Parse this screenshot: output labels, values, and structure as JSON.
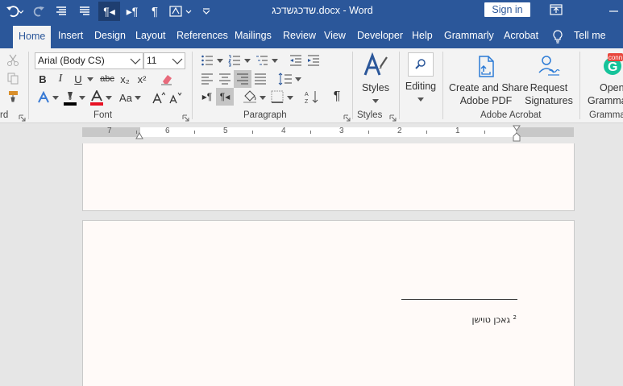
{
  "title_bar": {
    "document_title": "שדכגשדכג.docx  -  Word",
    "signin_label": "Sign in"
  },
  "tabs": [
    "Home",
    "Insert",
    "Design",
    "Layout",
    "References",
    "Mailings",
    "Review",
    "View",
    "Developer",
    "Help",
    "Grammarly",
    "Acrobat",
    "Tell me"
  ],
  "active_tab": "Home",
  "ribbon": {
    "clipboard_label": "rd",
    "font": {
      "font_name": "Arial (Body CS)",
      "font_size": "11",
      "label": "Font",
      "bold": "B",
      "italic": "I",
      "underline": "U",
      "strikethrough": "abc",
      "subscript": "x₂",
      "superscript": "x²",
      "change_case": "Aa"
    },
    "paragraph": {
      "label": "Paragraph"
    },
    "styles": {
      "button_label": "Styles",
      "label": "Styles"
    },
    "editing": {
      "button_label": "Editing"
    },
    "acrobat": {
      "create_share_line1": "Create and Share",
      "create_share_line2": "Adobe PDF",
      "request_line1": "Request",
      "request_line2": "Signatures",
      "label": "Adobe Acrobat"
    },
    "grammarly": {
      "open_line1": "Open",
      "open_line2": "Gramma",
      "label": "Gramma",
      "badge": "conn"
    }
  },
  "ruler": {
    "numbers": [
      "7",
      "6",
      "5",
      "4",
      "3",
      "2",
      "1"
    ]
  },
  "document": {
    "footnote_mark": "2",
    "footnote_text": "גאכן טוישן"
  },
  "colors": {
    "title_bar": "#2b579a",
    "ribbon_bg": "#f3f3f3",
    "font_color_red": "#e81123",
    "page_bg": "#fffaf8",
    "grammarly_green": "#15c39a"
  }
}
